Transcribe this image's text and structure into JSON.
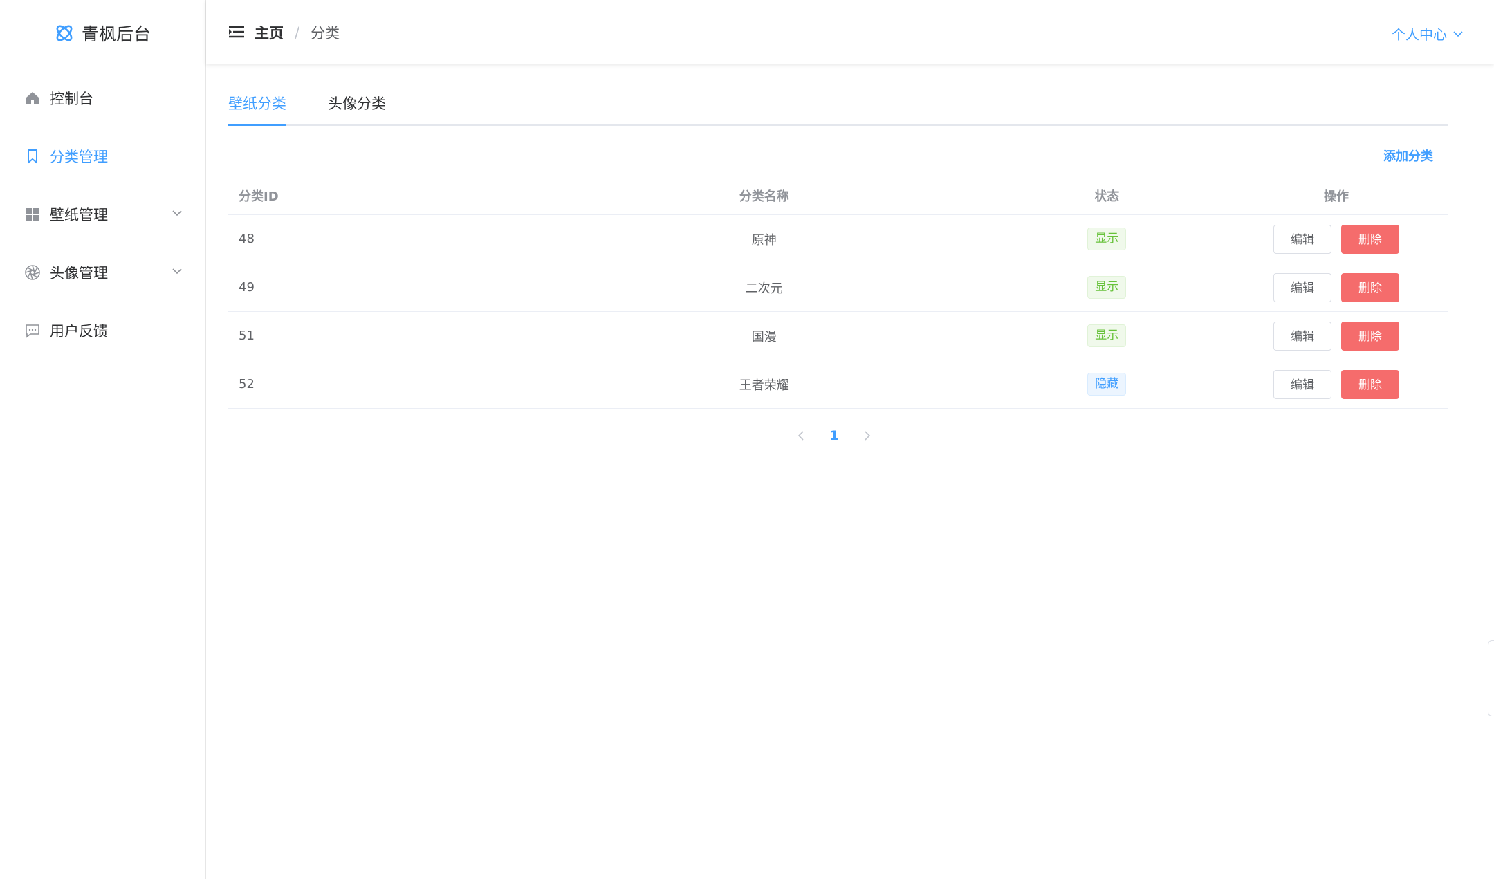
{
  "app": {
    "title": "青枫后台"
  },
  "sidebar": {
    "items": [
      {
        "label": "控制台",
        "icon": "home-icon"
      },
      {
        "label": "分类管理",
        "icon": "bookmark-icon",
        "active": true
      },
      {
        "label": "壁纸管理",
        "icon": "grid-icon",
        "expandable": true
      },
      {
        "label": "头像管理",
        "icon": "aperture-icon",
        "expandable": true
      },
      {
        "label": "用户反馈",
        "icon": "chat-icon"
      }
    ]
  },
  "header": {
    "breadcrumb": {
      "home": "主页",
      "separator": "/",
      "current": "分类"
    },
    "user_menu": "个人中心"
  },
  "tabs": [
    {
      "label": "壁纸分类",
      "active": true
    },
    {
      "label": "头像分类",
      "active": false
    }
  ],
  "toolbar": {
    "add_label": "添加分类"
  },
  "table": {
    "headers": {
      "id": "分类ID",
      "name": "分类名称",
      "status": "状态",
      "ops": "操作"
    },
    "rows": [
      {
        "id": "48",
        "name": "原神",
        "status": "显示"
      },
      {
        "id": "49",
        "name": "二次元",
        "status": "显示"
      },
      {
        "id": "51",
        "name": "国漫",
        "status": "显示"
      },
      {
        "id": "52",
        "name": "王者荣耀",
        "status": "隐藏"
      }
    ],
    "edit_label": "编辑",
    "delete_label": "删除"
  },
  "pagination": {
    "current": "1"
  },
  "colors": {
    "accent": "#409eff",
    "success": "#67c23a",
    "danger": "#f56c6c"
  }
}
